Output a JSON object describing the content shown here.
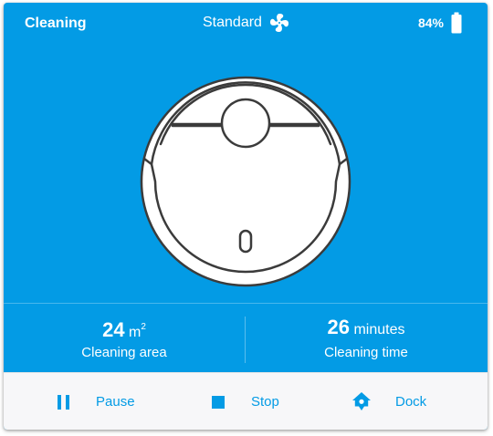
{
  "status": "Cleaning",
  "fan": {
    "mode": "Standard",
    "icon": "fan-icon"
  },
  "battery": {
    "level": "84%",
    "icon": "battery-icon"
  },
  "robot": {
    "icon": "robot-vacuum-illustration"
  },
  "stats": {
    "area": {
      "value": "24",
      "unit": "m",
      "unit_power": "2",
      "label": "Cleaning area"
    },
    "time": {
      "value": "26",
      "unit": "minutes",
      "label": "Cleaning time"
    }
  },
  "controls": {
    "pause": {
      "label": "Pause",
      "icon": "pause-icon"
    },
    "stop": {
      "label": "Stop",
      "icon": "stop-icon"
    },
    "dock": {
      "label": "Dock",
      "icon": "home-map-marker-icon"
    }
  },
  "colors": {
    "accent": "#039be5",
    "controls_background": "#f7f7f9",
    "text_on_accent": "#ffffff"
  }
}
